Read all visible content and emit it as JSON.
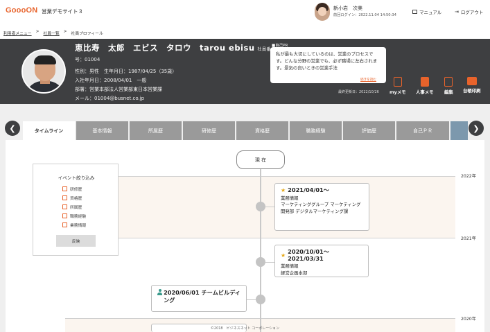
{
  "header": {
    "logo": "GoooON",
    "site_title": "営業デモサイト３",
    "user_name": "新小岩　次美",
    "last_login": "前回ログイン：2022.11.04 14:50:34",
    "manual_label": "マニュアル",
    "logout_label": "ログアウト"
  },
  "breadcrumb": {
    "items": [
      "利用者メニュー",
      ">",
      "社員一覧",
      ">",
      "社員プロフィール"
    ]
  },
  "profile": {
    "name": "恵比寿　太郎　エビス　タロウ　tarou ebisu",
    "badge": "社員番",
    "number": "号：01004",
    "gender_birth": "性別：男性　生年月日：1987/04/25（35歳）",
    "hire": "入社年月日：2008/04/01　一般",
    "department": "部署：営業本部法人営業部東日本営業課",
    "email": "メール：01004@busnet.co.jp",
    "pr_label": "■自己PR",
    "pr_text": "私が最も大切にしているのは、営業のプロセスです。どんな分野の営業でも、必ず職場に左右されます。景気の良いときの営業手法",
    "pr_more": "続きを読む",
    "updated": "最終更新日：2022/10/26",
    "actions": [
      {
        "label": "myメモ",
        "icon": "memo-icon"
      },
      {
        "label": "人事メモ",
        "icon": "hr-memo-icon"
      },
      {
        "label": "編集",
        "icon": "edit-icon"
      },
      {
        "label": "台帳印刷",
        "icon": "print-icon"
      }
    ]
  },
  "tabs": [
    "タイムライン",
    "基本情報",
    "所属歴",
    "研修歴",
    "資格歴",
    "職務経験",
    "評価歴",
    "自己ＰＲ"
  ],
  "filter": {
    "title": "イベント絞り込み",
    "items": [
      "研修歴",
      "資格歴",
      "所属歴",
      "職務経験",
      "業務情報"
    ],
    "apply_label": "反映"
  },
  "timeline": {
    "now_label": "現 在",
    "years": [
      "2022年",
      "2021年",
      "2020年"
    ],
    "events": [
      {
        "date": "2021/04/01～",
        "category": "業務情報",
        "detail": "マーケティンググループ マーケティング開発部 デジタルマーケティング課"
      },
      {
        "date": "2020/10/01～2021/03/31",
        "category": "業務情報",
        "detail": "経営企画本部"
      },
      {
        "date": "2020/06/01 チームビルディング",
        "category": "",
        "detail": ""
      }
    ]
  },
  "footer": "©2018　ビジネスネット コーポレーション"
}
